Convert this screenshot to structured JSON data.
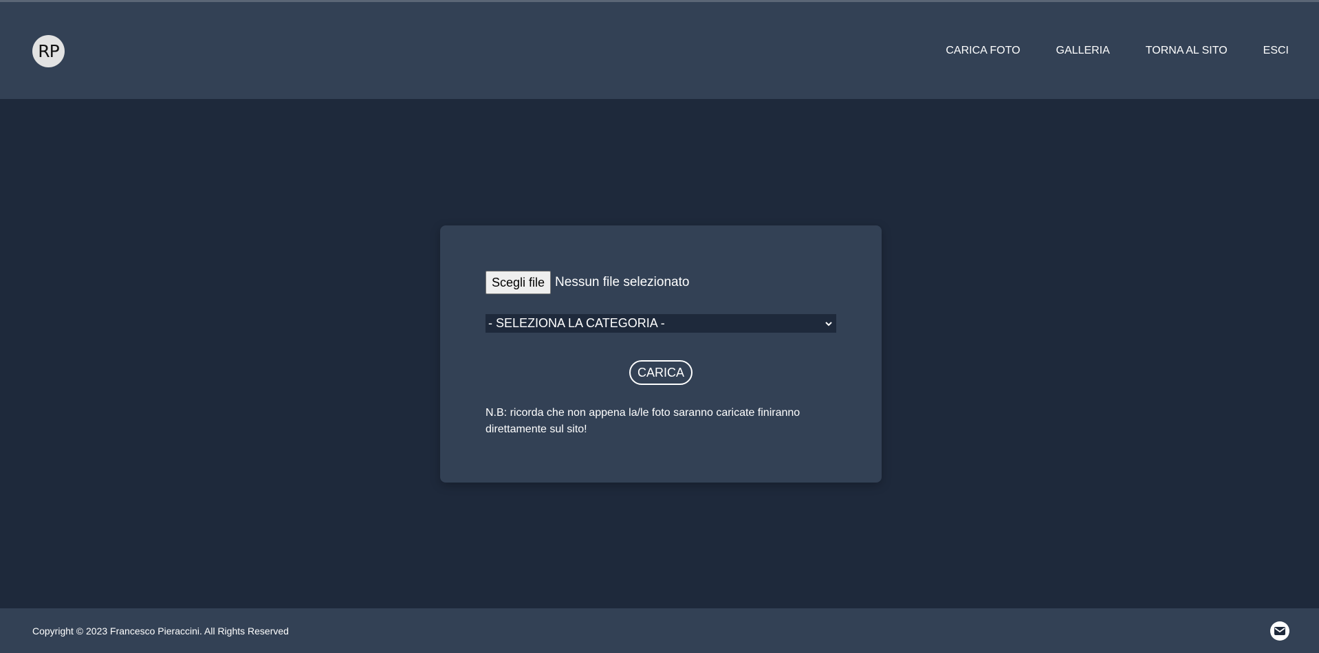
{
  "header": {
    "logo_text": "RP",
    "nav": [
      {
        "label": "CARICA FOTO"
      },
      {
        "label": "GALLERIA"
      },
      {
        "label": "TORNA AL SITO"
      },
      {
        "label": "ESCI"
      }
    ]
  },
  "upload_form": {
    "file_button_label": "Scegli file",
    "file_status": "Nessun file selezionato",
    "category_select_value": "- SELEZIONA LA CATEGORIA -",
    "submit_label": "CARICA",
    "note": "N.B: ricorda che non appena la/le foto saranno caricate finiranno direttamente sul sito!"
  },
  "footer": {
    "copyright": "Copyright © 2023 Francesco Pieraccini. All Rights Reserved",
    "mail_icon": "envelope-icon"
  },
  "colors": {
    "background": "#1e293b",
    "panel": "#334155",
    "text": "#ffffff"
  }
}
